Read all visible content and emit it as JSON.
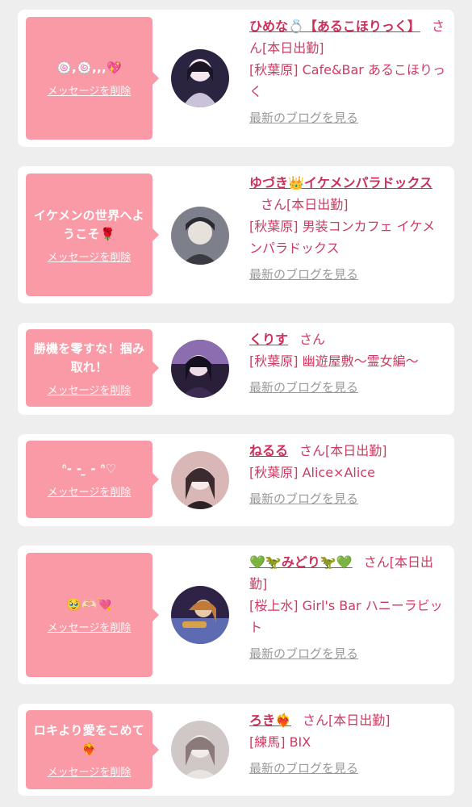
{
  "common": {
    "delete_label": "メッセージを削除",
    "san": "さん",
    "blog_label": "最新のブログを見る"
  },
  "cards": [
    {
      "message": "🍥,🍥,,,💖",
      "name": "ひめな💍【あるこほりっく】",
      "status": "[本日出勤]",
      "shop": "[秋葉原] Cafe&Bar あるこほりっく",
      "avatar_colors": [
        "#2b2440",
        "#c9c2d8",
        "#f3e6ee"
      ]
    },
    {
      "message": "イケメンの世界へようこそ🌹",
      "name": "ゆづき👑イケメンパラドックス",
      "status": "[本日出勤]",
      "shop": "[秋葉原] 男装コンカフェ イケメンパラドックス",
      "avatar_colors": [
        "#3a3a42",
        "#7d7f8a",
        "#e7e1dc"
      ]
    },
    {
      "message": "勝機を零すな！掴み取れ！",
      "name": "くりす",
      "status": "",
      "shop": "[秋葉原] 幽遊屋敷〜霊女編〜",
      "avatar_colors": [
        "#2a1f38",
        "#8c6db0",
        "#efdbe8"
      ]
    },
    {
      "message": "ᐢ‐ ‐ ̫ ‐ ᐢ♡",
      "name": "ねるる",
      "status": "[本日出勤]",
      "shop": "[秋葉原] Alice×Alice",
      "avatar_colors": [
        "#3c2b2e",
        "#d9b7b7",
        "#f6eaea"
      ]
    },
    {
      "message": "🥹🫶🏻💘",
      "name": "💚🦖みどり🦖💚",
      "status": "[本日出勤]",
      "shop": "[桜上水] Girl's Bar ハニーラビット",
      "avatar_colors": [
        "#2e2347",
        "#c07a3a",
        "#5d6bb3"
      ]
    },
    {
      "message": "ロキより愛をこめて❤️‍🔥",
      "name": "ろき❤️‍🔥",
      "status": "[本日出勤]",
      "shop": "[練馬] BIX",
      "avatar_colors": [
        "#cfc8c6",
        "#8a7a78",
        "#f1ecea"
      ]
    }
  ]
}
